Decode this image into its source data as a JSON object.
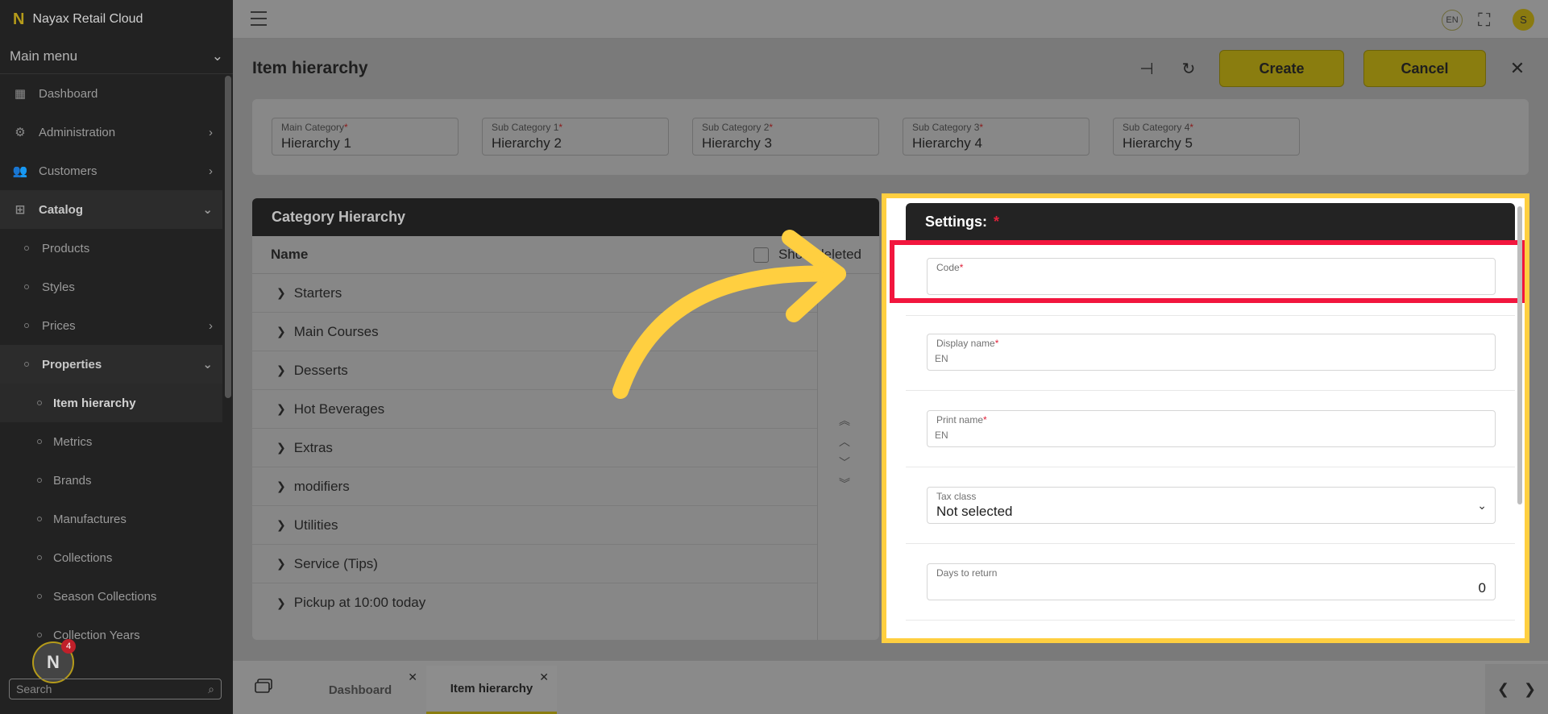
{
  "app": {
    "name": "Nayax Retail Cloud",
    "logo_letter": "N"
  },
  "sidebar": {
    "menu_label": "Main menu",
    "items": [
      {
        "label": "Dashboard",
        "icon": "dashboard-icon"
      },
      {
        "label": "Administration",
        "icon": "gear-icon"
      },
      {
        "label": "Customers",
        "icon": "users-icon"
      },
      {
        "label": "Catalog",
        "icon": "grid-icon"
      },
      {
        "label": "Products"
      },
      {
        "label": "Styles"
      },
      {
        "label": "Prices"
      },
      {
        "label": "Properties"
      },
      {
        "label": "Item hierarchy"
      },
      {
        "label": "Metrics"
      },
      {
        "label": "Brands"
      },
      {
        "label": "Manufactures"
      },
      {
        "label": "Collections"
      },
      {
        "label": "Season Collections"
      },
      {
        "label": "Collection Years"
      }
    ],
    "notification_count": "4",
    "search_placeholder": "Search"
  },
  "topbar": {
    "lang": "EN",
    "user_initial": "S"
  },
  "page": {
    "title": "Item hierarchy",
    "create_label": "Create",
    "cancel_label": "Cancel"
  },
  "categories": [
    {
      "label": "Main Category",
      "value": "Hierarchy 1"
    },
    {
      "label": "Sub Category 1",
      "value": "Hierarchy 2"
    },
    {
      "label": "Sub Category 2",
      "value": "Hierarchy 3"
    },
    {
      "label": "Sub Category 3",
      "value": "Hierarchy 4"
    },
    {
      "label": "Sub Category 4",
      "value": "Hierarchy 5"
    }
  ],
  "hierarchy_panel": {
    "title": "Category Hierarchy",
    "name_header": "Name",
    "show_deleted_label": "Show deleted",
    "rows": [
      "Starters",
      "Main Courses",
      "Desserts",
      "Hot Beverages",
      "Extras",
      "modifiers",
      "Utilities",
      "Service (Tips)",
      "Pickup at 10:00 today"
    ]
  },
  "settings": {
    "title": "Settings:",
    "code_label": "Code",
    "code_value": "",
    "display_name_label": "Display name",
    "display_name_lang": "EN",
    "print_name_label": "Print name",
    "print_name_lang": "EN",
    "tax_class_label": "Tax class",
    "tax_class_value": "Not selected",
    "days_to_return_label": "Days to return",
    "days_to_return_value": "0"
  },
  "tabs": [
    {
      "label": "Dashboard"
    },
    {
      "label": "Item hierarchy"
    }
  ],
  "colors": {
    "accent": "#ffcf40",
    "highlight": "#f2163e",
    "required": "#e0213a"
  }
}
